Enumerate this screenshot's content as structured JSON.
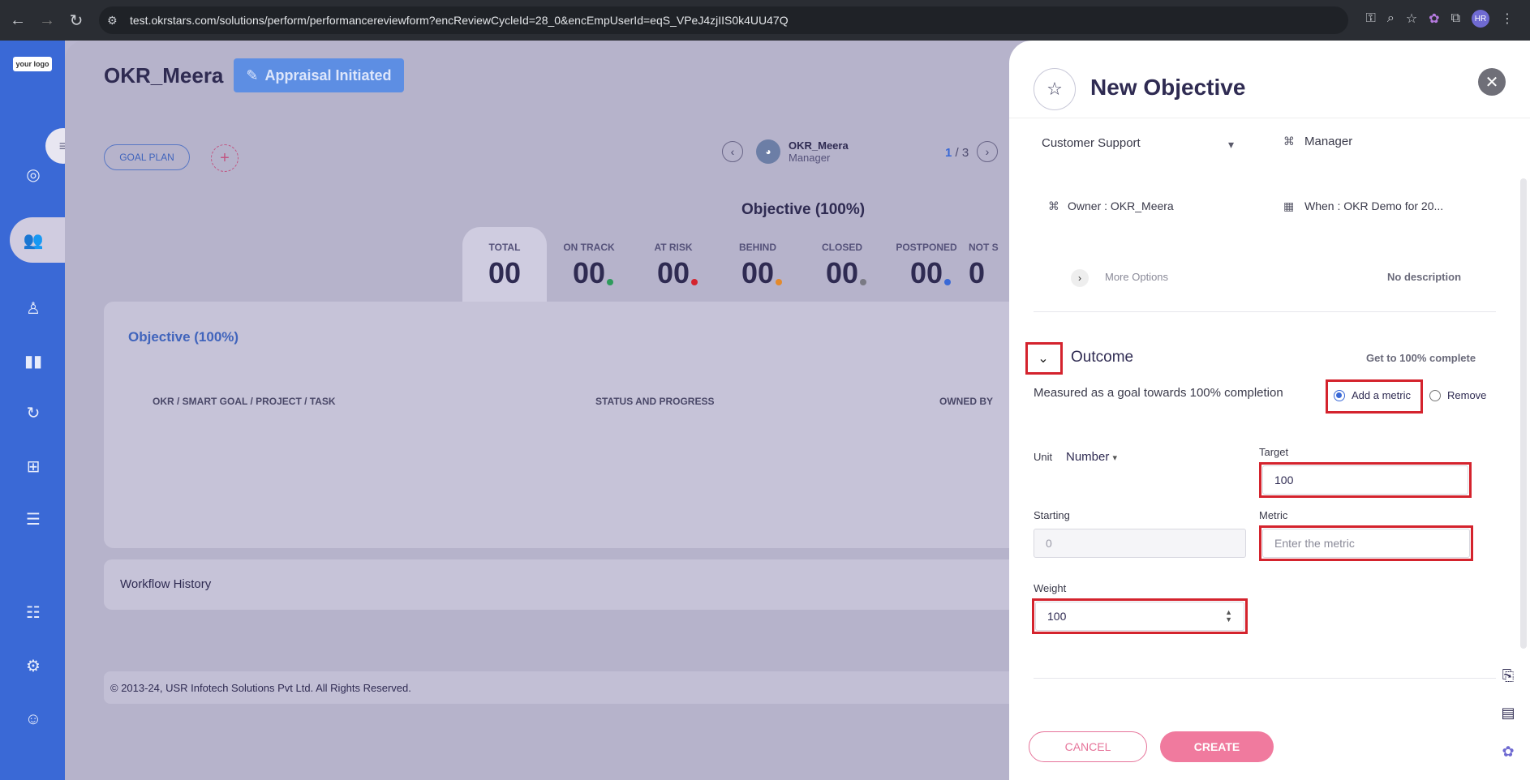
{
  "browser": {
    "url": "test.okrstars.com/solutions/perform/performancereviewform?encReviewCycleId=28_0&encEmpUserId=eqS_VPeJ4zjIIS0k4UU47Q",
    "profile_initials": "HR"
  },
  "sidebar": {
    "logo_text": "your logo"
  },
  "header": {
    "title": "OKR_Meera",
    "status_badge": "Appraisal Initiated",
    "goal_plan_label": "GOAL PLAN"
  },
  "pager": {
    "user_name": "OKR_Meera",
    "user_role": "Manager",
    "current": "1",
    "separator": "/",
    "total": "3"
  },
  "summary": {
    "heading": "Objective (100%)",
    "stats": [
      {
        "label": "TOTAL",
        "value": "00"
      },
      {
        "label": "ON TRACK",
        "value": "00",
        "dot_color": "#2e9b5c"
      },
      {
        "label": "AT RISK",
        "value": "00",
        "dot_color": "#d4232d"
      },
      {
        "label": "BEHIND",
        "value": "00",
        "dot_color": "#e38a2c"
      },
      {
        "label": "CLOSED",
        "value": "00",
        "dot_color": "#7a7a84"
      },
      {
        "label": "POSTPONED",
        "value": "00",
        "dot_color": "#3a69d6"
      },
      {
        "label": "NOT S",
        "value": "0"
      }
    ]
  },
  "objective_card": {
    "title": "Objective (100%)",
    "columns": [
      "OKR / SMART GOAL / PROJECT / TASK",
      "STATUS AND PROGRESS",
      "OWNED BY"
    ]
  },
  "workflow": {
    "label": "Workflow History"
  },
  "footer": {
    "copyright": "© 2013-24, USR Infotech Solutions Pvt Ltd. All Rights Reserved."
  },
  "panel": {
    "title": "New Objective",
    "department": "Customer Support",
    "role": "Manager",
    "owner": "Owner : OKR_Meera",
    "when": "When : OKR Demo for 20...",
    "more_options": "More Options",
    "no_description": "No description",
    "outcome": {
      "label": "Outcome",
      "progress_hint": "Get to 100% complete",
      "measured_text": "Measured as a goal towards 100% completion",
      "radio_add": "Add a metric",
      "radio_remove": "Remove",
      "unit_label": "Unit",
      "unit_value": "Number",
      "target_label": "Target",
      "target_value": "100",
      "starting_label": "Starting",
      "starting_value": "0",
      "metric_label": "Metric",
      "metric_placeholder": "Enter the metric",
      "weight_label": "Weight",
      "weight_value": "100"
    },
    "cancel_label": "CANCEL",
    "create_label": "CREATE"
  }
}
